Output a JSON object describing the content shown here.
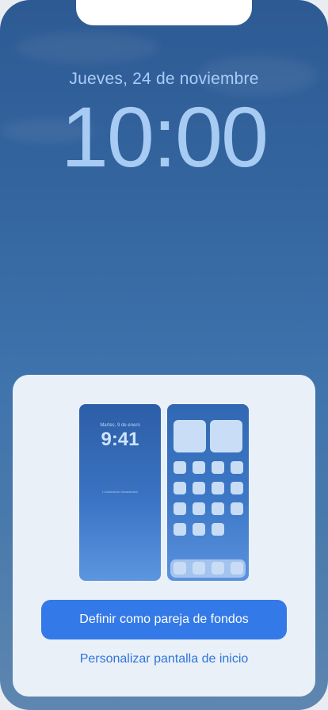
{
  "lock_screen": {
    "date": "Jueves, 24 de noviembre",
    "time": "10:00"
  },
  "wallpaper_sheet": {
    "preview_lock": {
      "date": "Martes, 9 de enero",
      "time": "9:41",
      "location": "Localización desactivada"
    },
    "primary_button_label": "Definir como pareja de fondos",
    "secondary_link_label": "Personalizar pantalla de inicio"
  }
}
